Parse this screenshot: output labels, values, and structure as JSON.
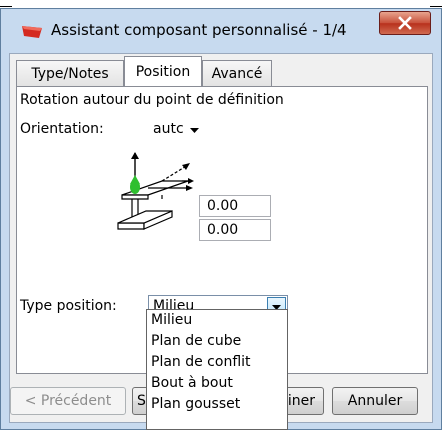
{
  "window": {
    "title": "Assistant composant personnalisé - 1/4",
    "close_label": "x"
  },
  "tabs": [
    {
      "label": "Type/Notes"
    },
    {
      "label": "Position"
    },
    {
      "label": "Avancé"
    }
  ],
  "panel": {
    "rotation_label": "Rotation autour du point de définition",
    "orientation_label": "Orientation:",
    "orientation_value": "autc",
    "offset_top_value": "0.00",
    "offset_bottom_value": "0.00",
    "type_position_label": "Type position:",
    "type_position_value": "Milieu"
  },
  "dropdown": {
    "options": [
      "Milieu",
      "Plan de cube",
      "Plan de conflit",
      "Bout à bout",
      "Plan gousset"
    ]
  },
  "buttons": {
    "previous": "< Précédent",
    "next_partial": "S",
    "finish_partial": "iner",
    "cancel": "Annuler"
  },
  "colors": {
    "frame": "#c7daef",
    "close_red": "#c8513b",
    "app_icon_red": "#d42a20",
    "beam_green": "#2fbf2f"
  }
}
